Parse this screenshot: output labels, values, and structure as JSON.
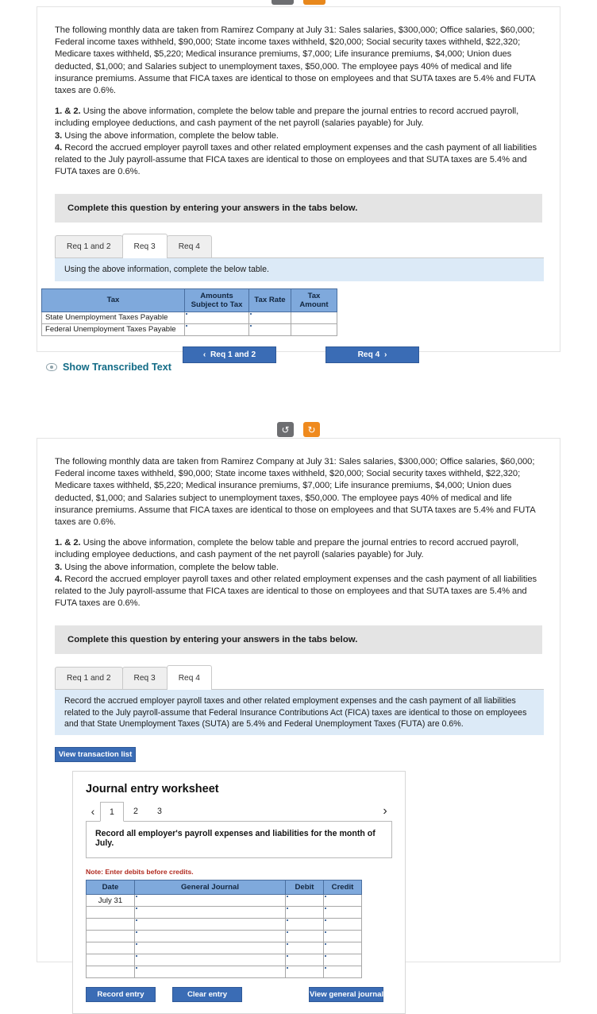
{
  "top_buttons": [
    {
      "name": "refresh-gray",
      "glyph": "↺",
      "color": "#6d6e71"
    },
    {
      "name": "refresh-orange",
      "glyph": "↻",
      "color": "#ef8a1e"
    }
  ],
  "problem_text": {
    "paragraph1": "The following monthly data are taken from Ramirez Company at July 31: Sales salaries, $300,000; Office salaries, $60,000; Federal income taxes withheld, $90,000; State income taxes withheld, $20,000; Social security taxes withheld, $22,320; Medicare taxes withheld, $5,220; Medical insurance premiums, $7,000; Life insurance premiums, $4,000; Union dues deducted, $1,000; and Salaries subject to unemployment taxes, $50,000. The employee pays 40% of medical and life insurance premiums. Assume that FICA taxes are identical to those on employees and that SUTA taxes are 5.4% and FUTA taxes are 0.6%.",
    "req12_label": "1. & 2.",
    "req12_text": " Using the above information, complete the below table and prepare the journal entries to record accrued payroll, including employee deductions, and cash payment of the net payroll (salaries payable) for July.",
    "req3_label": "3.",
    "req3_text": " Using the above information, complete the below table.",
    "req4_label": "4.",
    "req4_text": " Record the accrued employer payroll taxes and other related employment expenses and the cash payment of all liabilities related to the July payroll-assume that FICA taxes are identical to those on employees and that SUTA taxes are 5.4% and FUTA taxes are 0.6%."
  },
  "instruction_bar": "Complete this question by entering your answers in the tabs below.",
  "tabs": [
    {
      "label": "Req 1 and 2"
    },
    {
      "label": "Req 3"
    },
    {
      "label": "Req 4"
    }
  ],
  "panel1": {
    "active_tab_index": 1,
    "band_text": "Using the above information, complete the below table.",
    "table": {
      "headers": [
        "Tax",
        "Amounts Subject to Tax",
        "Tax Rate",
        "Tax Amount"
      ],
      "rows": [
        {
          "tax": "State Unemployment Taxes Payable",
          "amount": "",
          "rate": "",
          "tax_amount": ""
        },
        {
          "tax": "Federal Unemployment Taxes Payable",
          "amount": "",
          "rate": "",
          "tax_amount": ""
        }
      ]
    },
    "nav_prev": "Req 1 and 2",
    "nav_next": "Req 4",
    "prev_arrow": "‹",
    "next_arrow": "›"
  },
  "show_transcribed": {
    "label": "Show Transcribed Text",
    "icon": "eye-icon"
  },
  "panel2": {
    "active_tab_index": 2,
    "band_text": "Record the accrued employer payroll taxes and other related employment expenses and the cash payment of all liabilities related to the July payroll-assume that Federal Insurance Contributions Act (FICA) taxes are identical to those on employees and that State Unemployment Taxes (SUTA) are 5.4% and Federal Unemployment Taxes (FUTA) are 0.6%.",
    "view_transaction_list": "View transaction list",
    "worksheet": {
      "title": "Journal entry worksheet",
      "prev_arrow": "‹",
      "next_arrow": "›",
      "pages": [
        "1",
        "2",
        "3"
      ],
      "active_page_index": 0,
      "prompt": "Record all employer's payroll expenses and liabilities for the month of July.",
      "note": "Note: Enter debits before credits.",
      "table": {
        "headers": [
          "Date",
          "General Journal",
          "Debit",
          "Credit"
        ],
        "rows": [
          {
            "date": "July 31",
            "journal": "",
            "debit": "",
            "credit": ""
          },
          {
            "date": "",
            "journal": "",
            "debit": "",
            "credit": ""
          },
          {
            "date": "",
            "journal": "",
            "debit": "",
            "credit": ""
          },
          {
            "date": "",
            "journal": "",
            "debit": "",
            "credit": ""
          },
          {
            "date": "",
            "journal": "",
            "debit": "",
            "credit": ""
          },
          {
            "date": "",
            "journal": "",
            "debit": "",
            "credit": ""
          },
          {
            "date": "",
            "journal": "",
            "debit": "",
            "credit": ""
          }
        ]
      },
      "buttons": {
        "record_entry": "Record entry",
        "clear_entry": "Clear entry",
        "view_general_journal": "View general journal"
      }
    }
  }
}
